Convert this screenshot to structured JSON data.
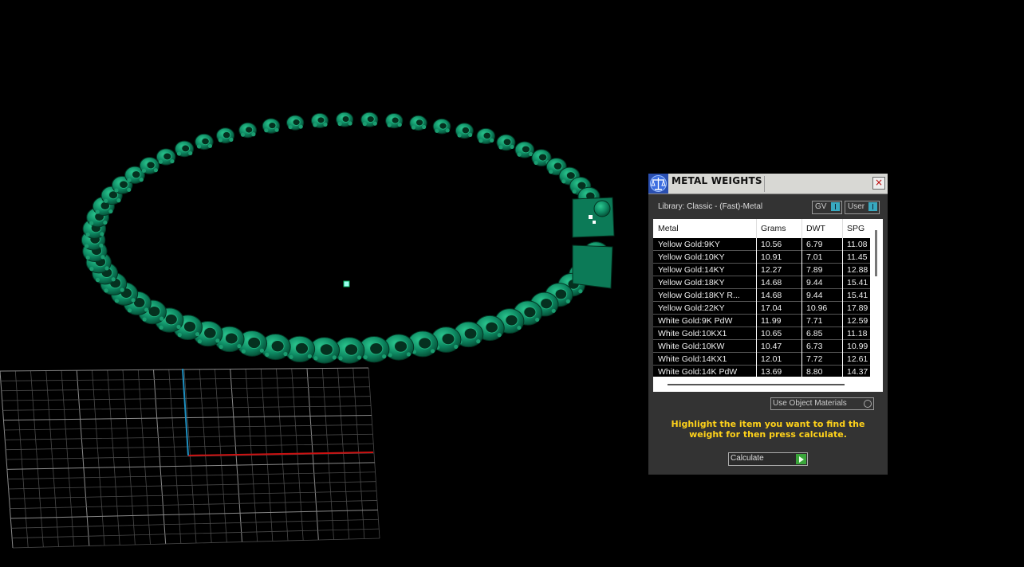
{
  "panel": {
    "title": "METAL WEIGHTS",
    "close_label": "×",
    "library": "Library: Classic - (Fast)-Metal",
    "gv_label": "GV",
    "user_label": "User",
    "columns": [
      "Metal",
      "Grams",
      "DWT",
      "SPG"
    ],
    "rows": [
      [
        "Yellow Gold:9KY",
        "10.56",
        "6.79",
        "11.08"
      ],
      [
        "Yellow Gold:10KY",
        "10.91",
        "7.01",
        "11.45"
      ],
      [
        "Yellow Gold:14KY",
        "12.27",
        "7.89",
        "12.88"
      ],
      [
        "Yellow Gold:18KY",
        "14.68",
        "9.44",
        "15.41"
      ],
      [
        "Yellow Gold:18KY R...",
        "14.68",
        "9.44",
        "15.41"
      ],
      [
        "Yellow Gold:22KY",
        "17.04",
        "10.96",
        "17.89"
      ],
      [
        "White Gold:9K PdW",
        "11.99",
        "7.71",
        "12.59"
      ],
      [
        "White Gold:10KX1",
        "10.65",
        "6.85",
        "11.18"
      ],
      [
        "White Gold:10KW",
        "10.47",
        "6.73",
        "10.99"
      ],
      [
        "White Gold:14KX1",
        "12.01",
        "7.72",
        "12.61"
      ],
      [
        "White Gold:14K PdW",
        "13.69",
        "8.80",
        "14.37"
      ]
    ],
    "use_materials_label": "Use Object Materials",
    "hint": "Highlight the item you want to find the weight for then press calculate.",
    "calculate_label": "Calculate"
  },
  "colors": {
    "model": "#0e8a63",
    "hint": "#ffd21a",
    "accent": "#38a9c0",
    "calculate": "#3aa53a",
    "axis_x": "#cc1111",
    "axis_y": "#1e8fc0"
  }
}
